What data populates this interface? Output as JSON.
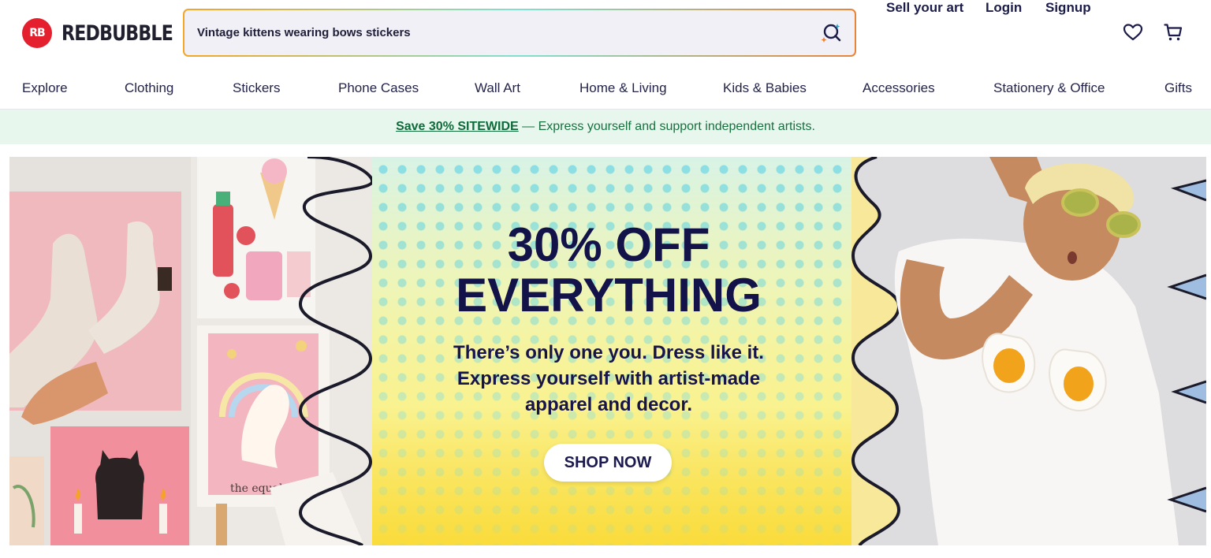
{
  "header": {
    "logo_text": "REDBUBBLE",
    "logo_mark": "RB",
    "search": {
      "value": "Vintage kittens wearing bows stickers",
      "icon": "ai-search-icon"
    },
    "links": {
      "sell": "Sell your art",
      "login": "Login",
      "signup": "Signup"
    },
    "icons": [
      "heart-icon",
      "cart-icon"
    ]
  },
  "nav": {
    "items": [
      "Explore",
      "Clothing",
      "Stickers",
      "Phone Cases",
      "Wall Art",
      "Home & Living",
      "Kids & Babies",
      "Accessories",
      "Stationery & Office",
      "Gifts"
    ]
  },
  "promo": {
    "link_text": "Save 30% SITEWIDE",
    "rest_text": " — Express yourself and support independent artists."
  },
  "hero": {
    "title_line1": "30% OFF",
    "title_line2": "EVERYTHING",
    "sub_line1": "There’s only one you. Dress like it.",
    "sub_line2": "Express yourself with artist-made",
    "sub_line3": "apparel and decor.",
    "cta": "SHOP NOW",
    "art_caption": "the equal"
  },
  "colors": {
    "brand_red": "#e4202e",
    "navy": "#131249",
    "promo_bg": "#e8f7ee",
    "promo_text": "#17713f"
  }
}
